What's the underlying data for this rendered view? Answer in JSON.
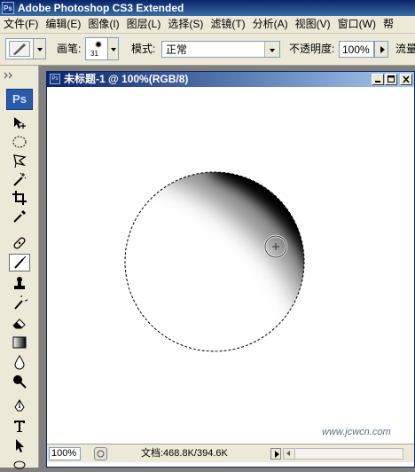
{
  "app": {
    "title": "Adobe Photoshop CS3 Extended",
    "icon": "Ps"
  },
  "menu": [
    {
      "name": "file",
      "label": "文件(F)"
    },
    {
      "name": "edit",
      "label": "编辑(E)"
    },
    {
      "name": "image",
      "label": "图像(I)"
    },
    {
      "name": "layer",
      "label": "图层(L)"
    },
    {
      "name": "select",
      "label": "选择(S)"
    },
    {
      "name": "filter",
      "label": "滤镜(T)"
    },
    {
      "name": "analysis",
      "label": "分析(A)"
    },
    {
      "name": "view",
      "label": "视图(V)"
    },
    {
      "name": "window",
      "label": "窗口(W)"
    },
    {
      "name": "help",
      "label": "帮"
    }
  ],
  "options": {
    "brush_label": "画笔:",
    "brush_size": "31",
    "mode_label": "模式:",
    "mode_value": "正常",
    "opacity_label": "不透明度:",
    "opacity_value": "100%",
    "flow_label": "流量"
  },
  "toolbox": {
    "logo": "Ps",
    "tools": [
      "move-icon",
      "elliptical-marquee-icon",
      "lasso-icon",
      "magic-wand-icon",
      "crop-icon",
      "eyedropper-icon",
      "healing-brush-icon",
      "brush-icon",
      "clone-stamp-icon",
      "history-brush-icon",
      "eraser-icon",
      "gradient-icon",
      "blur-icon",
      "dodge-icon",
      "pen-icon",
      "type-icon",
      "path-selection-icon",
      "shape-icon"
    ],
    "active_tool": "brush-icon"
  },
  "document": {
    "title": "未标题-1 @ 100%(RGB/8)",
    "icon": "Ps",
    "zoom": "100%",
    "doc_info": "文档:468.8K/394.6K",
    "watermark": "www.jcwcn.com"
  },
  "colors": {
    "title_bar": "#0a246a",
    "menu_bg": "#ece9d8",
    "canvas_bg": "#ffffff",
    "workspace": "#7f7f7f"
  }
}
